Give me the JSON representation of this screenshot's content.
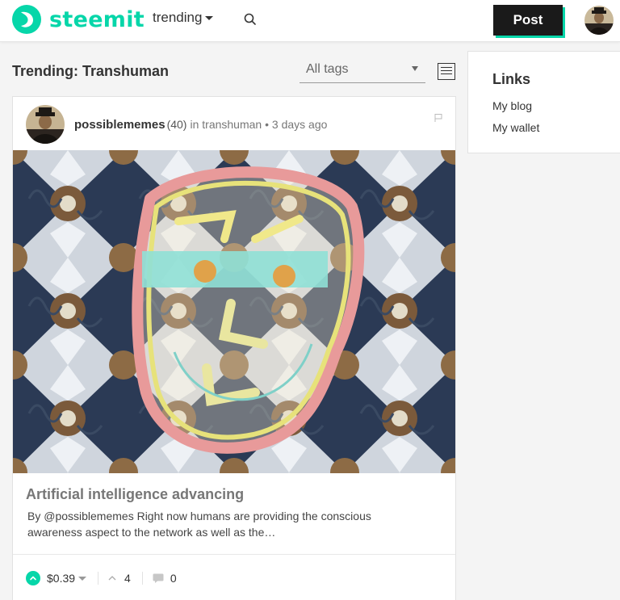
{
  "header": {
    "brand": "steemit",
    "sort_label": "trending",
    "post_button": "Post",
    "brand_color": "#06d6a9"
  },
  "feed": {
    "title": "Trending: Transhuman",
    "tag_filter": "All tags"
  },
  "post": {
    "author": "possiblememes",
    "reputation": "(40)",
    "community_prefix": "in",
    "community": "transhuman",
    "separator": "•",
    "time_ago": "3 days ago",
    "title": "Artificial intelligence advancing",
    "excerpt": "By @possiblememes Right now humans are providing the conscious awareness aspect to the network as well as the…",
    "payout": "$0.39",
    "votes": "4",
    "comments": "0"
  },
  "sidebar": {
    "heading": "Links",
    "links": [
      "My blog",
      "My wallet"
    ]
  },
  "icons": {
    "logo": "steemit-logo-icon",
    "search": "search-icon",
    "menu": "list-layout-icon",
    "flag": "flag-icon",
    "upvote": "upvote-icon",
    "votes": "chevron-up-icon",
    "comments": "comment-icon"
  }
}
